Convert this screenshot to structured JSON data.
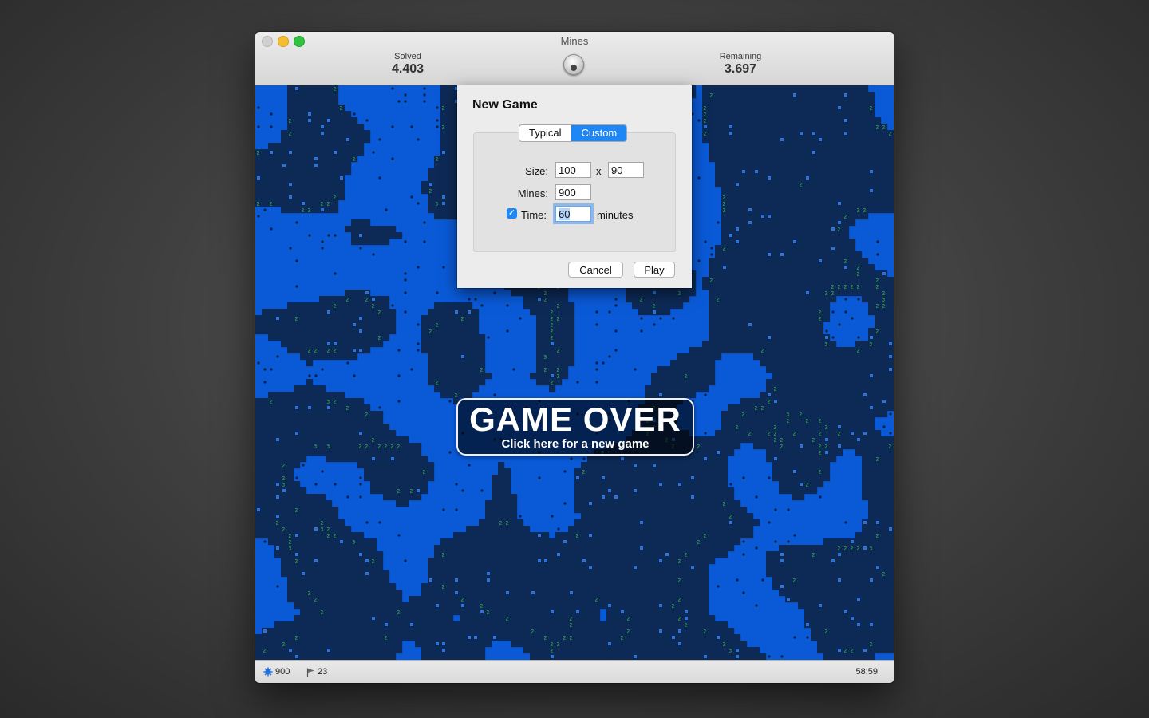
{
  "window": {
    "title": "Mines"
  },
  "stats": {
    "solved_label": "Solved",
    "solved_value": "4.403",
    "remaining_label": "Remaining",
    "remaining_value": "3.697"
  },
  "status_bar": {
    "mines": "900",
    "flags": "23",
    "time": "58:59"
  },
  "game_over": {
    "title": "GAME OVER",
    "subtitle": "Click here for a new game"
  },
  "dialog": {
    "title": "New Game",
    "tabs": [
      {
        "label": "Typical",
        "active": false
      },
      {
        "label": "Custom",
        "active": true
      }
    ],
    "size_label": "Size:",
    "size_width": "100",
    "size_sep": "x",
    "size_height": "90",
    "mines_label": "Mines:",
    "mines_value": "900",
    "time_label": "Time:",
    "time_value": "60",
    "time_unit": "minutes",
    "time_enabled": true,
    "cancel_label": "Cancel",
    "play_label": "Play"
  },
  "board": {
    "columns": 100,
    "rows": 90,
    "colors": {
      "unrevealed": "#0a5ad8",
      "revealed": "#0d2a57",
      "number": "#3fd93a",
      "mine": "#0a1f45"
    }
  }
}
